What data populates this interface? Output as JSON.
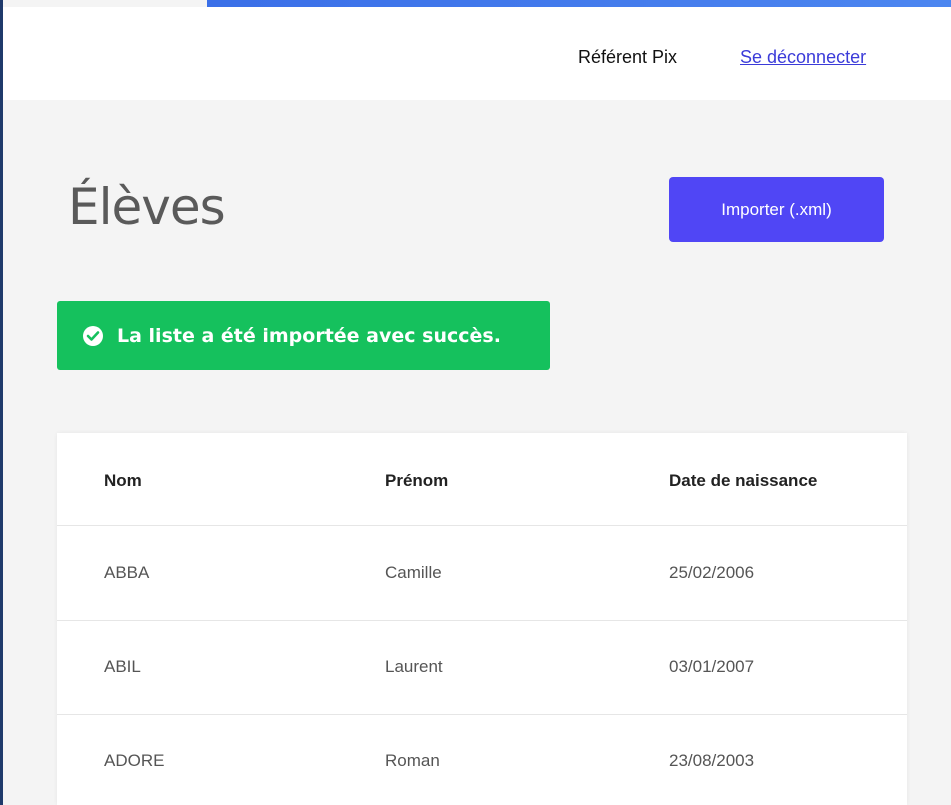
{
  "header": {
    "user_name": "Référent Pix",
    "logout_label": "Se déconnecter"
  },
  "page": {
    "title": "Élèves",
    "import_button_label": "Importer (.xml)"
  },
  "alert": {
    "message": "La liste a été importée avec succès.",
    "icon": "check-circle-icon",
    "color": "#15c15d"
  },
  "table": {
    "columns": [
      "Nom",
      "Prénom",
      "Date de naissance"
    ],
    "rows": [
      [
        "ABBA",
        "Camille",
        "25/02/2006"
      ],
      [
        "ABIL",
        "Laurent",
        "03/01/2007"
      ],
      [
        "ADORE",
        "Roman",
        "23/08/2003"
      ]
    ]
  },
  "colors": {
    "accent": "#5046f5",
    "link": "#3b3bd9"
  }
}
